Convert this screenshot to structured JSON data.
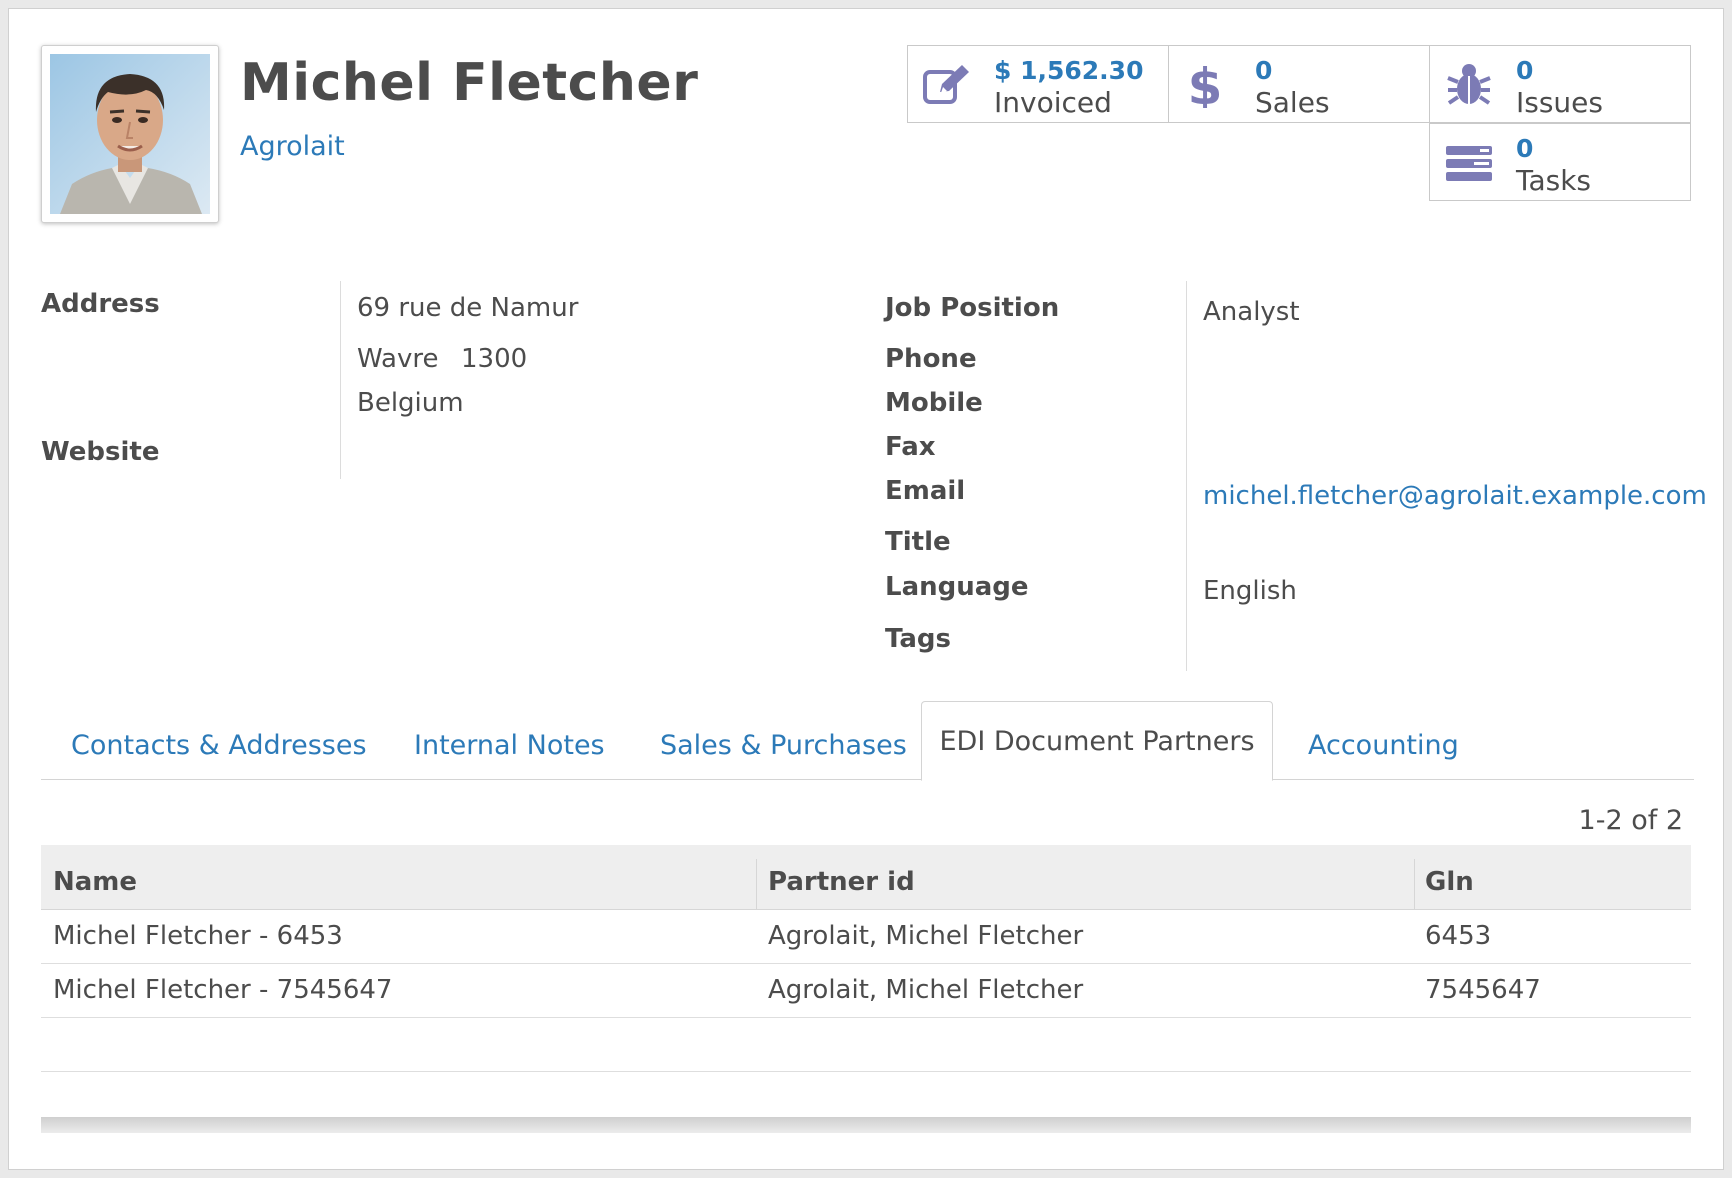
{
  "contact": {
    "name": "Michel Fletcher",
    "company": "Agrolait"
  },
  "stats": {
    "invoiced": {
      "value": "$ 1,562.30",
      "label": "Invoiced",
      "icon": "edit-icon"
    },
    "sales": {
      "value": "0",
      "label": "Sales",
      "icon": "dollar-icon"
    },
    "issues": {
      "value": "0",
      "label": "Issues",
      "icon": "bug-icon"
    },
    "tasks": {
      "value": "0",
      "label": "Tasks",
      "icon": "tasks-icon"
    }
  },
  "left_fields": {
    "address_label": "Address",
    "address_line1": "69 rue de Namur",
    "city": "Wavre",
    "zip": "1300",
    "country": "Belgium",
    "website_label": "Website"
  },
  "right_fields": {
    "job_position_label": "Job Position",
    "job_position": "Analyst",
    "phone_label": "Phone",
    "mobile_label": "Mobile",
    "fax_label": "Fax",
    "email_label": "Email",
    "email": "michel.fletcher@agrolait.example.com",
    "title_label": "Title",
    "language_label": "Language",
    "language": "English",
    "tags_label": "Tags"
  },
  "tabs": [
    {
      "label": "Contacts & Addresses"
    },
    {
      "label": "Internal Notes"
    },
    {
      "label": "Sales & Purchases"
    },
    {
      "label": "EDI Document Partners",
      "active": true
    },
    {
      "label": "Accounting"
    }
  ],
  "pager": "1-2 of 2",
  "table": {
    "columns": [
      "Name",
      "Partner id",
      "Gln"
    ],
    "rows": [
      [
        "Michel Fletcher - 6453",
        "Agrolait, Michel Fletcher",
        "6453"
      ],
      [
        "Michel Fletcher - 7545647",
        "Agrolait, Michel Fletcher",
        "7545647"
      ]
    ]
  },
  "colors": {
    "link": "#2c7ab8",
    "icon": "#7c7bb5",
    "text": "#4c4c4c"
  }
}
